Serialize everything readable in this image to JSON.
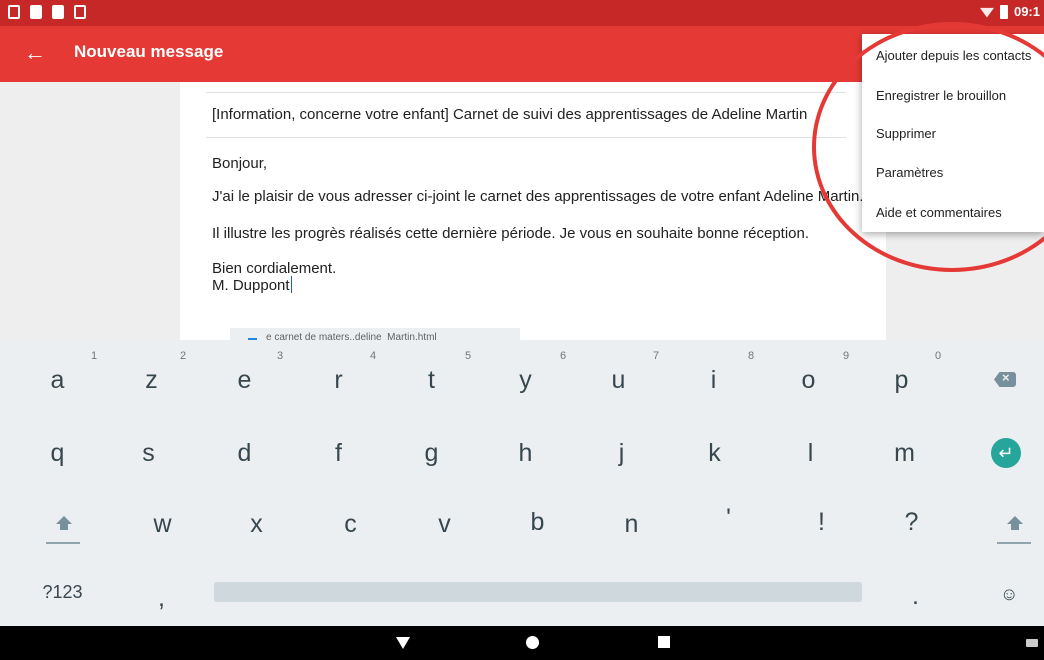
{
  "status_bar": {
    "time": "09:1"
  },
  "app_bar": {
    "back": "←",
    "title": "Nouveau message"
  },
  "email": {
    "subject": "[Information, concerne votre enfant] Carnet de suivi des apprentissages de Adeline Martin",
    "body": [
      "Bonjour,",
      "J'ai le plaisir de vous adresser ci-joint le carnet des apprentissages de votre enfant Adeline Martin.",
      "Il illustre les progrès réalisés cette dernière période. Je vous en souhaite bonne réception.",
      "Bien cordialement.",
      "M. Duppont"
    ],
    "attachment": "e carnet de maters..deline_Martin.html"
  },
  "menu": {
    "items": [
      "Ajouter depuis les contacts",
      "Enregistrer le brouillon",
      "Supprimer",
      "Paramètres",
      "Aide et commentaires"
    ]
  },
  "keyboard": {
    "row1": [
      "a",
      "z",
      "e",
      "r",
      "t",
      "y",
      "u",
      "i",
      "o",
      "p"
    ],
    "row1_hints": [
      "1",
      "2",
      "3",
      "4",
      "5",
      "6",
      "7",
      "8",
      "9",
      "0"
    ],
    "row2": [
      "q",
      "s",
      "d",
      "f",
      "g",
      "h",
      "j",
      "k",
      "l",
      "m"
    ],
    "row3": [
      "w",
      "x",
      "c",
      "v",
      "b",
      "n",
      "'",
      "!",
      "?"
    ],
    "symbols_label": "?123",
    "comma": ",",
    "period": ".",
    "emoji": "☺",
    "enter": "↵",
    "backspace": "×"
  },
  "colors": {
    "status_bar": "#c62828",
    "app_bar": "#e53935",
    "annotation": "#e53935",
    "enter_key": "#26a69a",
    "keyboard_bg": "#eceff1"
  }
}
